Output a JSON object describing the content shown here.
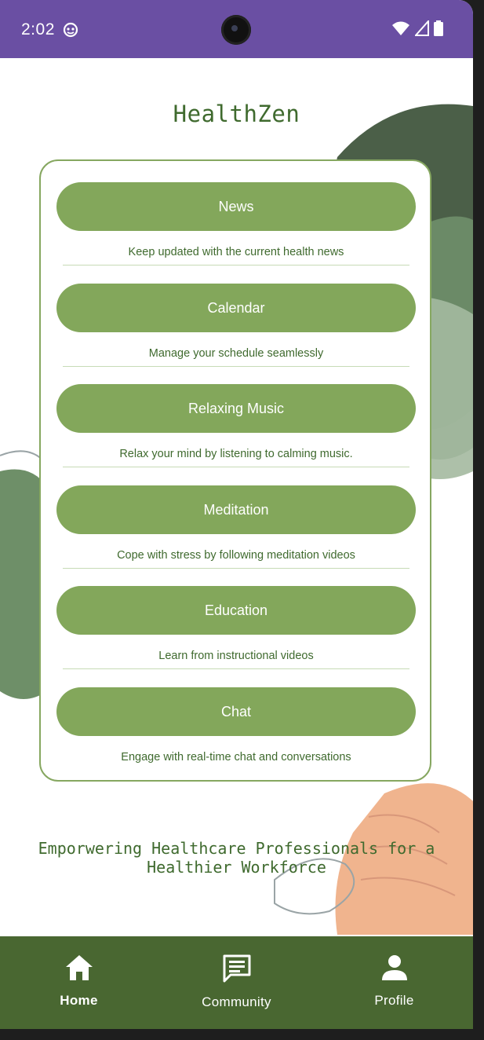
{
  "status_bar": {
    "time": "2:02"
  },
  "app": {
    "title": "HealthZen"
  },
  "features": [
    {
      "label": "News",
      "description": "Keep updated with the current health news"
    },
    {
      "label": "Calendar",
      "description": "Manage your schedule seamlessly"
    },
    {
      "label": "Relaxing Music",
      "description": "Relax your mind by listening to calming music."
    },
    {
      "label": "Meditation",
      "description": "Cope with stress by following meditation videos"
    },
    {
      "label": "Education",
      "description": "Learn from instructional videos"
    },
    {
      "label": "Chat",
      "description": "Engage with real-time chat and conversations"
    }
  ],
  "tagline": "Emporwering Healthcare Professionals for a Healthier Workforce",
  "bottom_nav": {
    "items": [
      {
        "label": "Home",
        "icon": "home-icon",
        "active": true
      },
      {
        "label": "Community",
        "icon": "chat-bubble-icon",
        "active": false
      },
      {
        "label": "Profile",
        "icon": "person-icon",
        "active": false
      }
    ]
  },
  "colors": {
    "status_bar": "#6a4fa3",
    "primary_green": "#83a75b",
    "text_green": "#3f6a2e",
    "nav_bg": "#496731"
  }
}
